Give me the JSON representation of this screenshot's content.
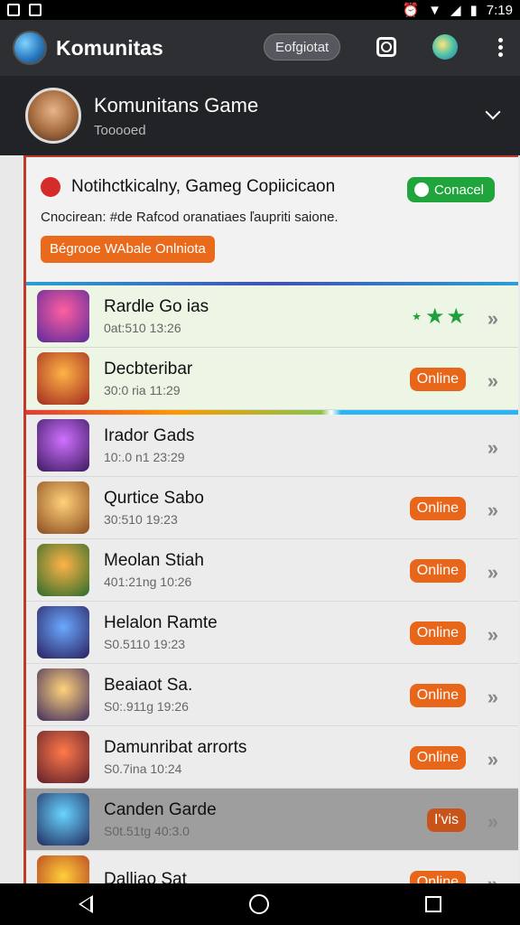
{
  "status_bar": {
    "time": "7:19"
  },
  "app_bar": {
    "title": "Komunitas",
    "pill_label": "Eofgiotat"
  },
  "profile": {
    "name": "Komunitans Game",
    "subtitle": "Tooooed"
  },
  "notice": {
    "title": "Notihctkicalny, Gameg Copiicicaon",
    "body": "Cnocirean: #de Rafcod oranatiaes ľaupriti saione.",
    "connect_label": "Conacel",
    "action_label": "Bégrooe WAbale Onlniota"
  },
  "games": [
    {
      "name": "Rardle Go ias",
      "sub": "0at:510   13:26",
      "status": "stars",
      "stars": "⋆★★",
      "icon_colors": [
        "#ff5fa0",
        "#5a2a9b"
      ]
    },
    {
      "name": "Decbteribar",
      "sub": "30:0 ria   11:29",
      "status": "Online",
      "icon_colors": [
        "#ffb347",
        "#a12b1f"
      ]
    },
    {
      "name": "Irador Gads",
      "sub": "10:.0 n1   23:29",
      "status": "",
      "icon_colors": [
        "#d070ff",
        "#3a1a5e"
      ]
    },
    {
      "name": "Qurtice Sabo",
      "sub": "30:510   19:23",
      "status": "Online",
      "icon_colors": [
        "#ffd27a",
        "#8a4b1e"
      ]
    },
    {
      "name": "Meolan Stiah",
      "sub": "401:21ng   10:26",
      "status": "Online",
      "icon_colors": [
        "#ffb347",
        "#2b6b2b"
      ]
    },
    {
      "name": "Helalon Ramte",
      "sub": "S0.5110   19:23",
      "status": "Online",
      "icon_colors": [
        "#6aa9ff",
        "#2a1f5e"
      ]
    },
    {
      "name": "Beaiaot Sa.",
      "sub": "S0:.911g   19:26",
      "status": "Online",
      "icon_colors": [
        "#ffd27a",
        "#3f2b5e"
      ]
    },
    {
      "name": "Damunribat arrorts",
      "sub": "S0.7ina   10:24",
      "status": "Online",
      "icon_colors": [
        "#ff7a4a",
        "#5e1f2b"
      ]
    },
    {
      "name": "Canden Garde",
      "sub": "S0t.51tg   40:3.0",
      "status": "I'vis",
      "icon_colors": [
        "#6ad4ff",
        "#1f2b5e"
      ]
    },
    {
      "name": "Dalliao Sat",
      "sub": "",
      "status": "Online",
      "icon_colors": [
        "#ffcf3a",
        "#b2361f"
      ]
    }
  ]
}
